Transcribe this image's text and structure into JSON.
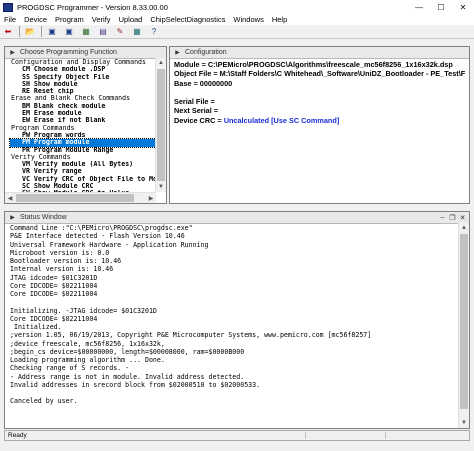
{
  "window": {
    "title": "PROGDSC Programmer - Version 8.33.00.00",
    "controls": [
      "—",
      "☐",
      "✕"
    ]
  },
  "menu": [
    "File",
    "Device",
    "Program",
    "Verify",
    "Upload",
    "ChipSelectDiagnostics",
    "Windows",
    "Help"
  ],
  "toolbar": {
    "buttons": [
      {
        "icon": "arrow-back-icon",
        "glyph": "⬅",
        "color": "#c00000"
      },
      {
        "icon": "folder-open-icon",
        "glyph": "📂",
        "color": "#c9a21b"
      },
      {
        "icon": "save-icon",
        "glyph": "▣",
        "color": "#1f3c8a"
      },
      {
        "icon": "save-all-icon",
        "glyph": "▣",
        "color": "#1f3c8a"
      },
      {
        "icon": "chip-select-icon",
        "glyph": "▦",
        "color": "#2a6e2a"
      },
      {
        "icon": "config-icon",
        "glyph": "▤",
        "color": "#5a3a8a"
      },
      {
        "icon": "edit-icon",
        "glyph": "✎",
        "color": "#8a1f1f"
      },
      {
        "icon": "grid-icon",
        "glyph": "▦",
        "color": "#1f6e6e"
      },
      {
        "icon": "help-icon",
        "glyph": "?",
        "color": "#1f3c8a"
      }
    ]
  },
  "commands_panel": {
    "title": "Choose Programming Function",
    "items": [
      {
        "text": "Configuration and Display Commands",
        "type": "header"
      },
      {
        "text": "CM Choose module .DSP",
        "type": "item"
      },
      {
        "text": "SS Specify Object File",
        "type": "item"
      },
      {
        "text": "SH Show module",
        "type": "item"
      },
      {
        "text": "RE Reset chip",
        "type": "item"
      },
      {
        "text": "Erase and Blank Check Commands",
        "type": "header"
      },
      {
        "text": "BM Blank check module",
        "type": "item"
      },
      {
        "text": "EM Erase module",
        "type": "item"
      },
      {
        "text": "EW Erase if not Blank",
        "type": "item"
      },
      {
        "text": "Program Commands",
        "type": "header"
      },
      {
        "text": "PW Program words",
        "type": "item"
      },
      {
        "text": "PM Program module",
        "type": "item",
        "selected": true
      },
      {
        "text": "PR Program Module Range",
        "type": "item"
      },
      {
        "text": "Verify Commands",
        "type": "header"
      },
      {
        "text": "VM Verify module (All Bytes)",
        "type": "item"
      },
      {
        "text": "VR Verify range",
        "type": "item"
      },
      {
        "text": "VC Verify CRC of Object File to Mod",
        "type": "item"
      },
      {
        "text": "SC Show Module CRC",
        "type": "item"
      },
      {
        "text": "SV Show Module CRC to Value",
        "type": "item"
      }
    ]
  },
  "config_panel": {
    "title": "Configuration",
    "rows": [
      {
        "key": "Module = ",
        "value": "C:\\PEMicro\\PROGDSC\\Algorithms\\freescale_mc56f8256_1x16x32k.dsp"
      },
      {
        "key": "Object File = ",
        "value": "M:\\Staff Folders\\C Whitehead\\_Software\\UniDZ_Bootloader - PE_Test\\FLASH_S"
      },
      {
        "key": "Base = ",
        "value": "00000000"
      },
      {
        "key": "",
        "value": ""
      },
      {
        "key": "Serial File = ",
        "value": ""
      },
      {
        "key": "Next Serial = ",
        "value": ""
      },
      {
        "key": "Device CRC = ",
        "value": "Uncalculated [Use SC Command]",
        "blue": true
      }
    ]
  },
  "status_panel": {
    "title": "Status Window",
    "lines": [
      "Command Line :\"C:\\PEMicro\\PROGDSC\\progdsc.exe\"",
      "P&E Interface detected - Flash Version 10.46",
      "Universal Framework Hardware - Application Running",
      "Microboot version is: 0.0",
      "Bootloader version is: 10.46",
      "Internal version is: 10.46",
      "JTAG idcode= $01C3201D",
      "Core IDCODE= $02211004",
      "Core IDCODE= $02211004",
      "",
      "Initializing. -JTAG idcode= $01C3201D",
      "Core IDCODE= $02211004",
      " Initialized.",
      ";version 1.05, 06/19/2013, Copyright P&E Microcomputer Systems, www.pemicro.com [mc56f8257]",
      ";device freescale, mc56f8256, 1x16x32k,",
      ";begin_cs device=$00000000, length=$00008000, ram=$0000B000",
      "Loading programming algorithm ... Done.",
      "Checking range of S records. -",
      "- Address range is not in module. Invalid address detected.",
      "Invalid addresses in srecord block from $02000510 to $02000533.",
      "",
      "Canceled by user."
    ]
  },
  "statusbar": {
    "text": "Ready"
  }
}
